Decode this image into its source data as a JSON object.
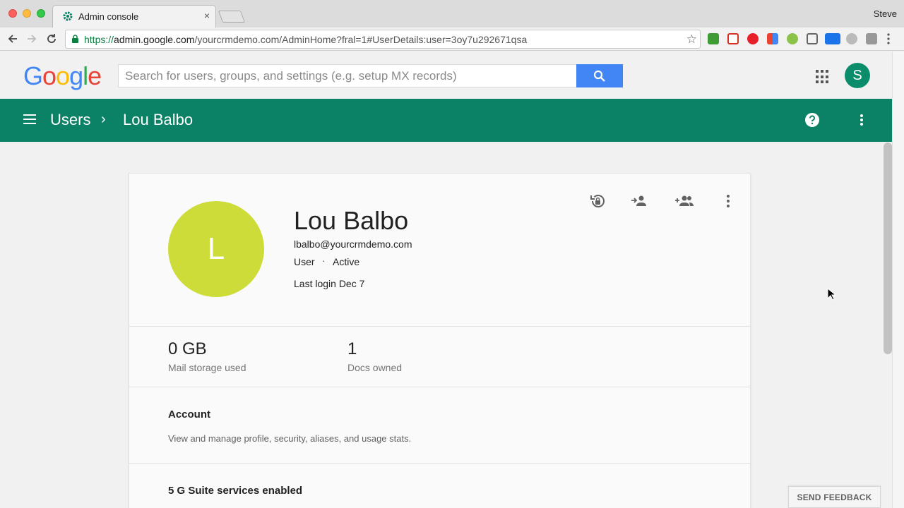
{
  "browser": {
    "tab_title": "Admin console",
    "tab_close": "×",
    "profile_name": "Steve",
    "url_prefix": "https://",
    "url_host": "admin.google.com",
    "url_path": "/yourcrmdemo.com/AdminHome?fral=1#UserDetails:user=3oy7u292671qsa",
    "star": "☆"
  },
  "header": {
    "logo_letters": [
      "G",
      "o",
      "o",
      "g",
      "l",
      "e"
    ],
    "logo_colors": [
      "#4285f4",
      "#ea4335",
      "#fbbc05",
      "#4285f4",
      "#34a853",
      "#ea4335"
    ],
    "search_placeholder": "Search for users, groups, and settings (e.g. setup MX records)",
    "account_initial": "S"
  },
  "appbar": {
    "crumb_parent": "Users",
    "crumb_sep": "›",
    "crumb_current": "Lou Balbo"
  },
  "user": {
    "initial": "L",
    "name": "Lou Balbo",
    "email": "lbalbo@yourcrmdemo.com",
    "role": "User",
    "dot": "·",
    "status": "Active",
    "last_login": "Last login Dec 7"
  },
  "stats": [
    {
      "value": "0 GB",
      "label": "Mail storage used"
    },
    {
      "value": "1",
      "label": "Docs owned"
    }
  ],
  "sections": [
    {
      "title": "Account",
      "desc": "View and manage profile, security, aliases, and usage stats."
    },
    {
      "title": "5 G Suite services enabled",
      "desc": ""
    }
  ],
  "feedback_label": "SEND FEEDBACK",
  "colors": {
    "appbar": "#0b8165",
    "avatar_user": "#cddc39",
    "avatar_account": "#0b8d6c",
    "search_button": "#4285f4"
  }
}
